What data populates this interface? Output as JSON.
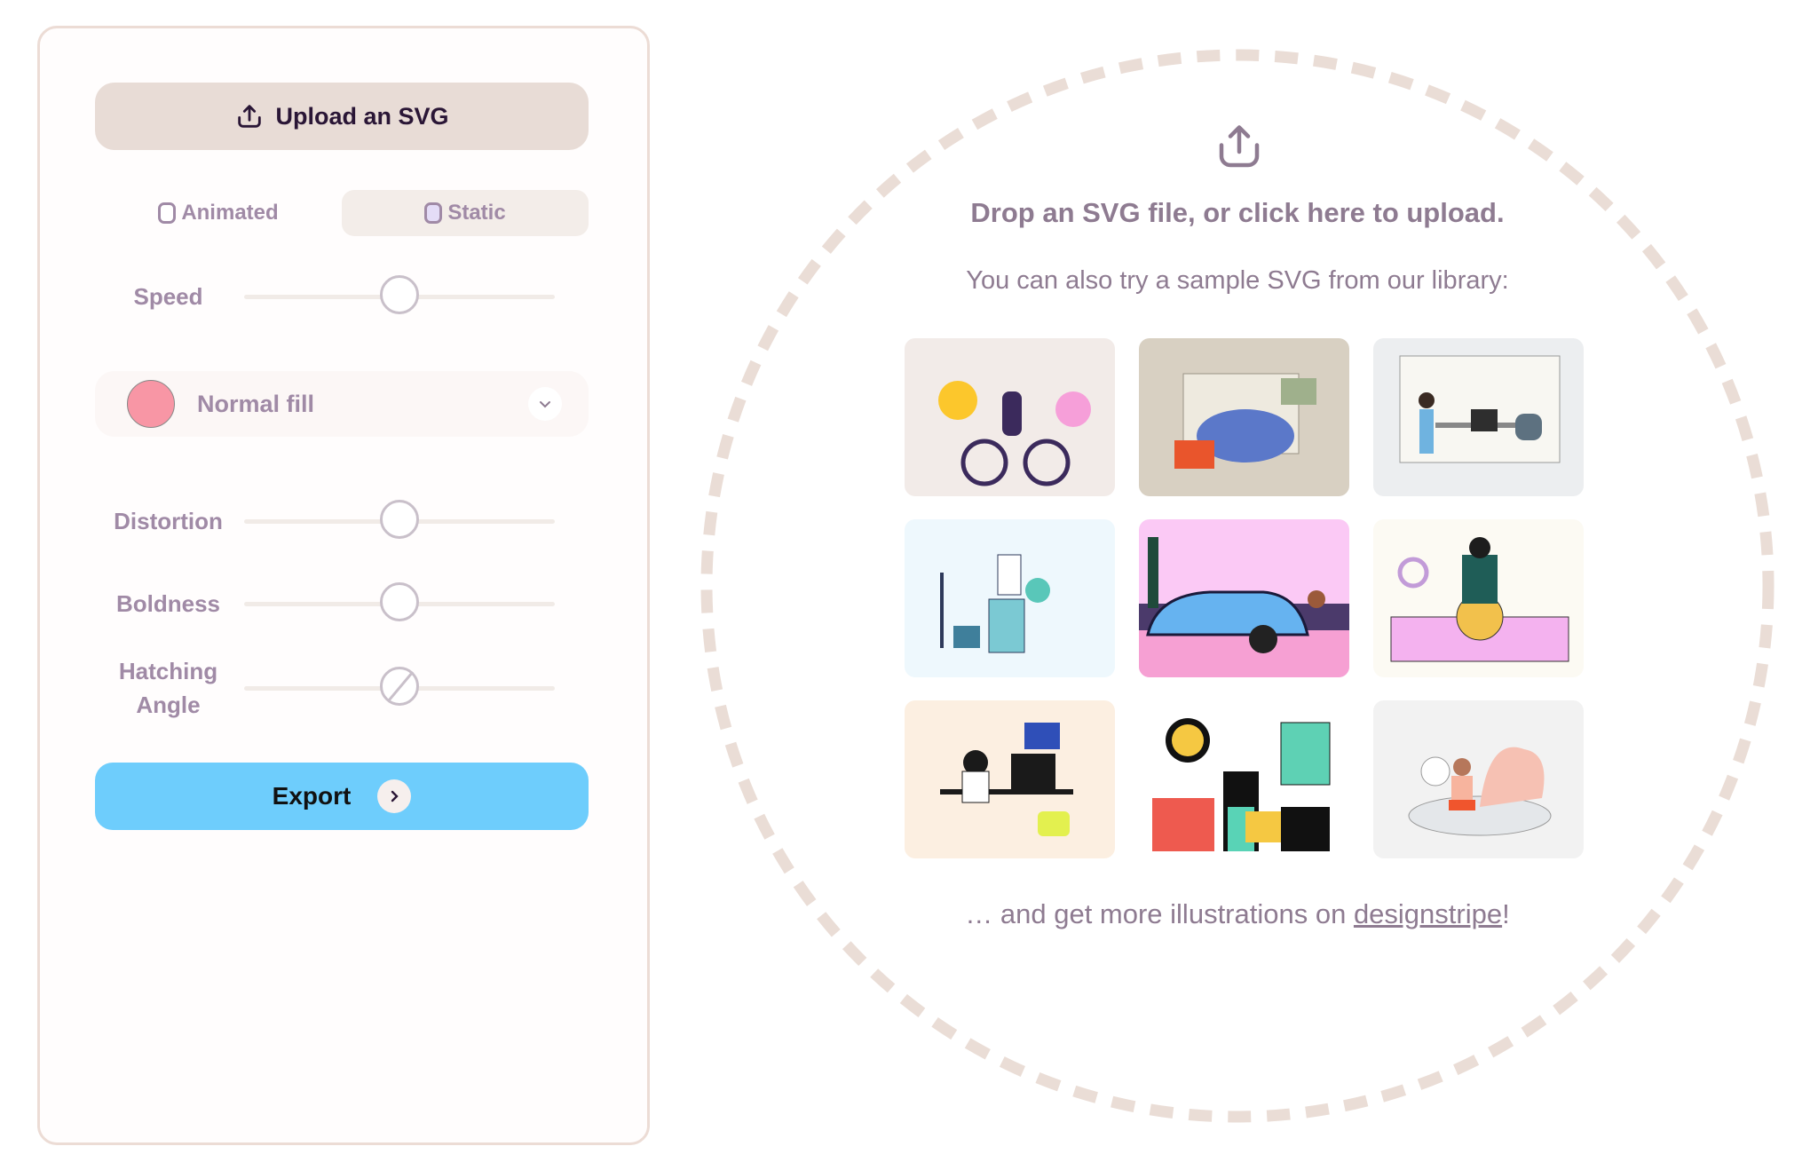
{
  "panel": {
    "upload_button": {
      "label": "Upload an SVG",
      "icon": "upload-icon"
    },
    "modes": [
      {
        "label": "Animated",
        "selected": false
      },
      {
        "label": "Static",
        "selected": true
      }
    ],
    "sliders": {
      "speed": {
        "label": "Speed",
        "value": 0.5
      },
      "distortion": {
        "label": "Distortion",
        "value": 0.5
      },
      "boldness": {
        "label": "Boldness",
        "value": 0.5
      },
      "hatching_angle": {
        "label_line1": "Hatching",
        "label_line2": "Angle",
        "value": 0.5
      }
    },
    "fill_select": {
      "label": "Normal fill",
      "swatch_color": "#f896a5",
      "icon": "chevron-down-icon"
    },
    "export_button": {
      "label": "Export",
      "icon": "chevron-right-icon"
    }
  },
  "dropzone": {
    "icon": "upload-icon",
    "title": "Drop an SVG file, or click here to upload.",
    "subtitle": "You can also try a sample SVG from our library:",
    "samples": [
      {
        "name": "cyclist-in-park",
        "bg": "#f2ebe8"
      },
      {
        "name": "person-at-laptop-thinking",
        "bg": "#d8d0c2"
      },
      {
        "name": "team-meeting",
        "bg": "#eceef0"
      },
      {
        "name": "stacked-boxes-stress",
        "bg": "#eef8fd"
      },
      {
        "name": "blue-car-beach",
        "bg": "#fbc9f5"
      },
      {
        "name": "cooking-salad",
        "bg": "#fcfaf3"
      },
      {
        "name": "gamer-streaming",
        "bg": "#fcefe1"
      },
      {
        "name": "business-collage",
        "bg": "#ffffff"
      },
      {
        "name": "meditation",
        "bg": "#f2f2f2"
      }
    ],
    "footer_prefix": "… and get more illustrations on ",
    "footer_link": "designstripe",
    "footer_suffix": "!"
  },
  "colors": {
    "accent_export": "#6ecdfc",
    "upload_button_bg": "#e8dcd6",
    "label_text": "#a08aa6",
    "dashed_ring": "#eaddd6"
  }
}
